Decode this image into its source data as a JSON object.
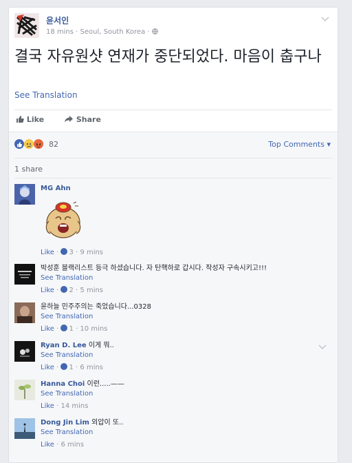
{
  "post": {
    "author": "윤서인",
    "time": "18 mins",
    "location": "Seoul, South Korea",
    "text": "결국 자유원샷 연재가 중단되었다. 마음이 춥구나",
    "see_translation": "See Translation",
    "like_label": "Like",
    "share_label": "Share",
    "reaction_count": "82",
    "top_comments_label": "Top Comments",
    "share_count": "1 share"
  },
  "colors": {
    "link": "#4267b2",
    "name": "#365899",
    "meta": "#90949c",
    "background": "#e9ebee"
  },
  "comments": [
    {
      "name": "MG Ahn",
      "text": "",
      "has_sticker": true,
      "translate": "",
      "like": "Like",
      "likes": "3",
      "time": "9 mins"
    },
    {
      "name": "",
      "text": "박성훈 블랙리스트 등극 하셨습니다. 자 탄핵하로 갑시다. 작성자 구속시키고!!!",
      "translate": "See Translation",
      "like": "Like",
      "likes": "2",
      "time": "5 mins"
    },
    {
      "name": "",
      "text": "윤하늘 민주주의는 죽었습니다...0328",
      "translate": "See Translation",
      "like": "Like",
      "likes": "1",
      "time": "10 mins"
    },
    {
      "name": "Ryan D. Lee",
      "text": "이게 뭐..",
      "translate": "See Translation",
      "like": "Like",
      "likes": "1",
      "time": "6 mins"
    },
    {
      "name": "Hanna Choi",
      "text": "이런.....——",
      "translate": "See Translation",
      "like": "Like",
      "likes": "",
      "time": "14 mins"
    },
    {
      "name": "Dong Jin Lim",
      "text": "외압이 또..",
      "translate": "See Translation",
      "like": "Like",
      "likes": "",
      "time": "6 mins"
    }
  ]
}
